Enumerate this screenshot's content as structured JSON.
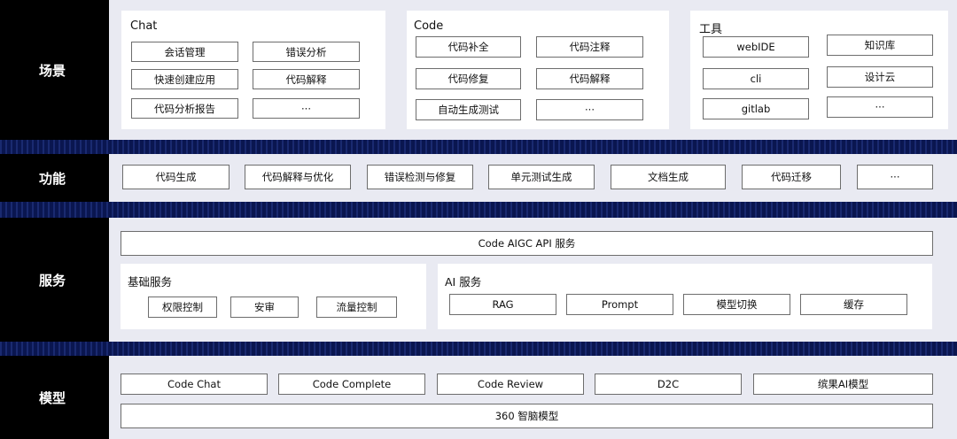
{
  "rows": {
    "scenarios": "场景",
    "functions": "功能",
    "services": "服务",
    "models": "模型"
  },
  "scenarios": {
    "chat": {
      "title": "Chat",
      "items": [
        "会话管理",
        "错误分析",
        "快速创建应用",
        "代码解释",
        "代码分析报告",
        "···"
      ]
    },
    "code": {
      "title": "Code",
      "items": [
        "代码补全",
        "代码注释",
        "代码修复",
        "代码解释",
        "自动生成测试",
        "···"
      ]
    },
    "tools": {
      "title": "工具",
      "items": [
        "webIDE",
        "知识库",
        "cli",
        "设计云",
        "gitlab",
        "···"
      ]
    }
  },
  "functions": [
    "代码生成",
    "代码解释与优化",
    "错误检测与修复",
    "单元测试生成",
    "文档生成",
    "代码迁移",
    "···"
  ],
  "services": {
    "api": "Code AIGC API 服务",
    "basic": {
      "title": "基础服务",
      "items": [
        "权限控制",
        "安审",
        "流量控制"
      ]
    },
    "ai": {
      "title": "AI 服务",
      "items": [
        "RAG",
        "Prompt",
        "模型切换",
        "缓存"
      ]
    }
  },
  "models": {
    "items": [
      "Code Chat",
      "Code Complete",
      "Code Review",
      "D2C",
      "缤果AI模型"
    ],
    "base": "360 智脑模型"
  }
}
